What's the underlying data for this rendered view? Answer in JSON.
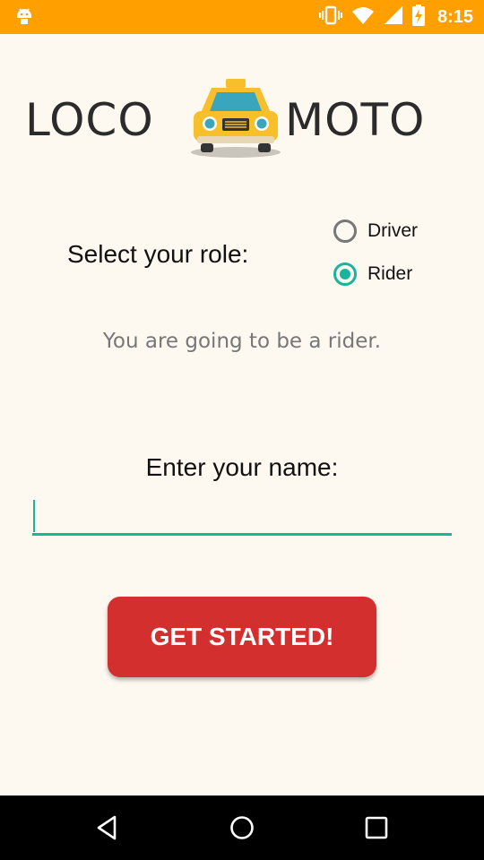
{
  "status_bar": {
    "time": "8:15",
    "icons": [
      "android-icon",
      "vibrate-icon",
      "wifi-icon",
      "signal-icon",
      "battery-charging-icon"
    ]
  },
  "logo": {
    "left_text": "LOCO",
    "right_text": "MOTO",
    "icon": "taxi-icon",
    "colors": {
      "text": "#2b2b2b",
      "taxi": "#f7c02b"
    }
  },
  "role": {
    "label": "Select your role:",
    "options": [
      {
        "label": "Driver",
        "checked": false
      },
      {
        "label": "Rider",
        "checked": true
      }
    ],
    "message": "You are going to be a rider."
  },
  "name": {
    "label": "Enter your name:",
    "value": "",
    "placeholder": ""
  },
  "actions": {
    "get_started_label": "GET STARTED!"
  },
  "colors": {
    "status_bar": "#ff9f00",
    "accent": "#1bb39c",
    "button": "#d32f2f",
    "background": "#fdf8f0"
  },
  "nav_bar": {
    "icons": [
      "back-icon",
      "home-icon",
      "recents-icon"
    ]
  }
}
